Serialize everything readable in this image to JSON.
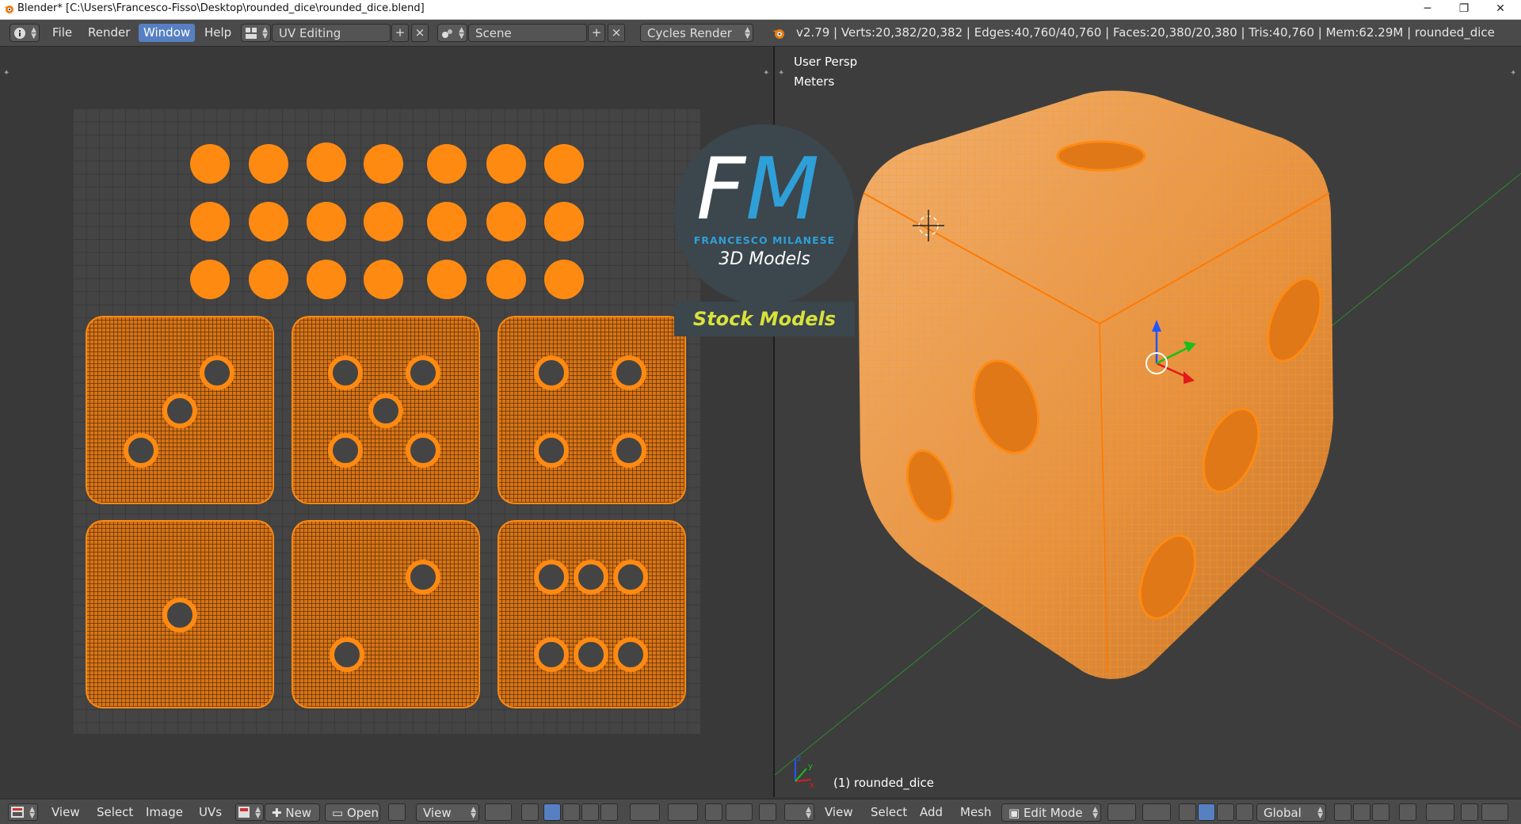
{
  "window": {
    "title": "Blender* [C:\\Users\\Francesco-Fisso\\Desktop\\rounded_dice\\rounded_dice.blend]",
    "minimize": "─",
    "maximize": "❐",
    "close": "✕"
  },
  "menu": {
    "file": "File",
    "render": "Render",
    "window": "Window",
    "help": "Help"
  },
  "screen_layout": "UV Editing",
  "scene": "Scene",
  "render_engine": "Cycles Render",
  "stats": "v2.79 | Verts:20,382/20,382 | Edges:40,760/40,760 | Faces:20,380/20,380 | Tris:40,760 | Mem:62.29M | rounded_dice",
  "viewport": {
    "view_name": "User Persp",
    "units": "Meters",
    "object_label": "(1) rounded_dice"
  },
  "logo": {
    "letters_f": "F",
    "letters_m": "M",
    "name": "FRANCESCO MILANESE",
    "tagline": "3D Models",
    "stock": "Stock Models",
    "colors": {
      "blue": "#2f9fd8",
      "yellow": "#d9e23b",
      "bg": "#3b464d"
    }
  },
  "uv_footer": {
    "view": "View",
    "select": "Select",
    "image": "Image",
    "uvs": "UVs",
    "new": "New",
    "open": "Open",
    "view2": "View"
  },
  "vp_footer": {
    "view": "View",
    "select": "Select",
    "add": "Add",
    "mesh": "Mesh",
    "mode": "Edit Mode",
    "orientation": "Global"
  },
  "colors": {
    "accent_orange": "#ff8a12",
    "menu_active": "#5680c2",
    "uv_bg": "#444444"
  }
}
